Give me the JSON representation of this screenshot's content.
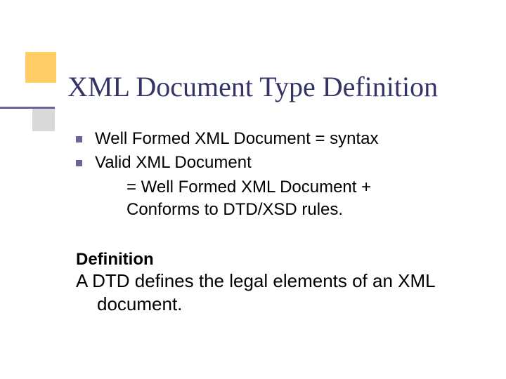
{
  "title": "XML Document Type Definition",
  "bullets": [
    {
      "text": "Well Formed XML Document = syntax"
    },
    {
      "text": "Valid XML Document"
    }
  ],
  "sublines": [
    "= Well Formed XML Document +",
    "Conforms to DTD/XSD rules."
  ],
  "definition": {
    "label": "Definition",
    "line1": "A DTD defines the legal elements of an XML",
    "line2": "document."
  }
}
